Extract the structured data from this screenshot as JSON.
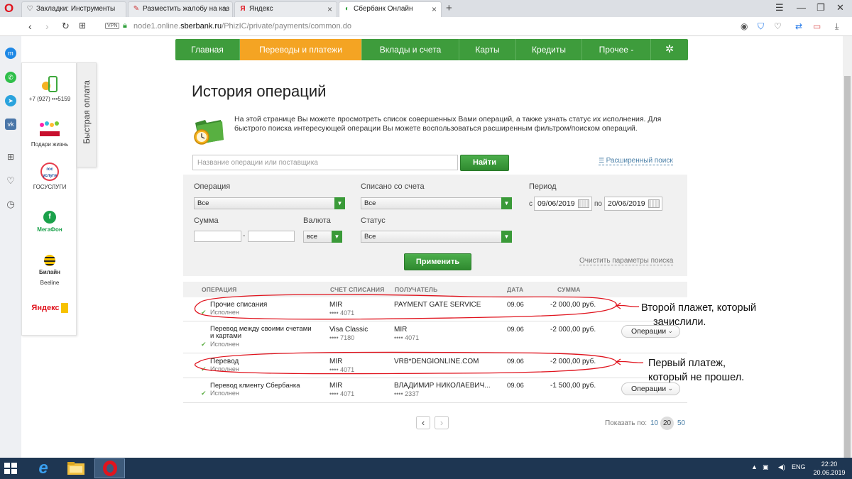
{
  "browser": {
    "tabs": [
      {
        "label": "Закладки: Инструменты",
        "icon": "heart-icon"
      },
      {
        "label": "Разместить жалобу на каз",
        "icon": "complaint-icon"
      },
      {
        "label": "Яндекс",
        "icon": "yandex-icon"
      },
      {
        "label": "Сбербанк Онлайн",
        "icon": "sberbank-icon",
        "active": true
      }
    ],
    "vpn": "VPN",
    "url_prefix": "node1.online.",
    "url_domain": "sberbank.ru",
    "url_path": "/PhizIC/private/payments/common.do"
  },
  "quick_pay": {
    "tab_label": "Быстрая оплата",
    "items": [
      {
        "label": "+7 (927) •••5159",
        "icon": "phone-icon"
      },
      {
        "label": "Подари жизнь",
        "icon": "podari-zhizn-logo"
      },
      {
        "label": "ГОСУСЛУГИ",
        "icon": "gosuslugi-logo",
        "logo_text": "гос услуги"
      },
      {
        "label": "МегаФон",
        "icon": "megafon-logo"
      },
      {
        "label": "Beeline",
        "icon": "beeline-logo",
        "logo_text": "Билайн"
      },
      {
        "label": "",
        "icon": "yandex-money-logo",
        "logo_text": "Яндекс"
      }
    ]
  },
  "nav": {
    "items": [
      "Главная",
      "Переводы и платежи",
      "Вклады и счета",
      "Карты",
      "Кредиты",
      "Прочее -"
    ],
    "active_index": 1,
    "settings_icon": "gear-icon"
  },
  "page": {
    "title": "История операций",
    "intro": "На этой странице Вы можете просмотреть список совершенных Вами операций, а также узнать статус их исполнения. Для быстрого поиска интересующей операции Вы можете воспользоваться расширенным фильтром/поиском операций.",
    "search_placeholder": "Название операции или поставщика",
    "search_button": "Найти",
    "advanced_search": "Расширенный поиск"
  },
  "filters": {
    "operation_label": "Операция",
    "operation_value": "Все",
    "account_label": "Списано со счета",
    "account_value": "Все",
    "period_label": "Период",
    "period_from_label": "с",
    "period_from": "09/06/2019",
    "period_to_label": "по",
    "period_to": "20/06/2019",
    "amount_label": "Сумма",
    "amount_dash": "-",
    "currency_label": "Валюта",
    "currency_value": "все",
    "status_label": "Статус",
    "status_value": "Все",
    "apply_button": "Применить",
    "clear_link": "Очистить параметры поиска"
  },
  "table": {
    "headers": [
      "ОПЕРАЦИЯ",
      "СЧЕТ СПИСАНИЯ",
      "ПОЛУЧАТЕЛЬ",
      "ДАТА",
      "СУММА"
    ],
    "rows": [
      {
        "operation": "Прочие списания",
        "status": "Исполнен",
        "account": "MIR",
        "account_num": "•••• 4071",
        "recipient": "PAYMENT GATE SERVICE",
        "recipient_num": "",
        "date": "09.06",
        "amount": "-2 000,00 руб.",
        "has_ops": false
      },
      {
        "operation": "Перевод между своими счетами и картами",
        "status": "Исполнен",
        "account": "Visa Classic",
        "account_num": "•••• 7180",
        "recipient": "MIR",
        "recipient_num": "•••• 4071",
        "date": "09.06",
        "amount": "-2 000,00 руб.",
        "has_ops": true
      },
      {
        "operation": "Перевод",
        "status": "Исполнен",
        "account": "MIR",
        "account_num": "•••• 4071",
        "recipient": "VRB*DENGIONLINE.COM",
        "recipient_num": "",
        "date": "09.06",
        "amount": "-2 000,00 руб.",
        "has_ops": false
      },
      {
        "operation": "Перевод клиенту Сбербанка",
        "status": "Исполнен",
        "account": "MIR",
        "account_num": "•••• 4071",
        "recipient": "ВЛАДИМИР НИКОЛАЕВИЧ...",
        "recipient_num": "•••• 2337",
        "date": "09.06",
        "amount": "-1 500,00 руб.",
        "has_ops": true
      }
    ],
    "ops_button": "Операции"
  },
  "pagination": {
    "show_label": "Показать по:",
    "sizes": [
      "10",
      "20",
      "50"
    ],
    "selected": "20"
  },
  "annotations": {
    "note1_line1": "Второй плажет, который",
    "note1_line2": "зачислили.",
    "note2_line1": "Первый платеж,",
    "note2_line2": "который не прошел."
  },
  "taskbar": {
    "lang": "ENG",
    "time": "22:20",
    "date": "20.06.2019"
  },
  "colors": {
    "sber_green": "#3e9c3c",
    "active_orange": "#f4a423",
    "annotation_red": "#e0141e"
  }
}
